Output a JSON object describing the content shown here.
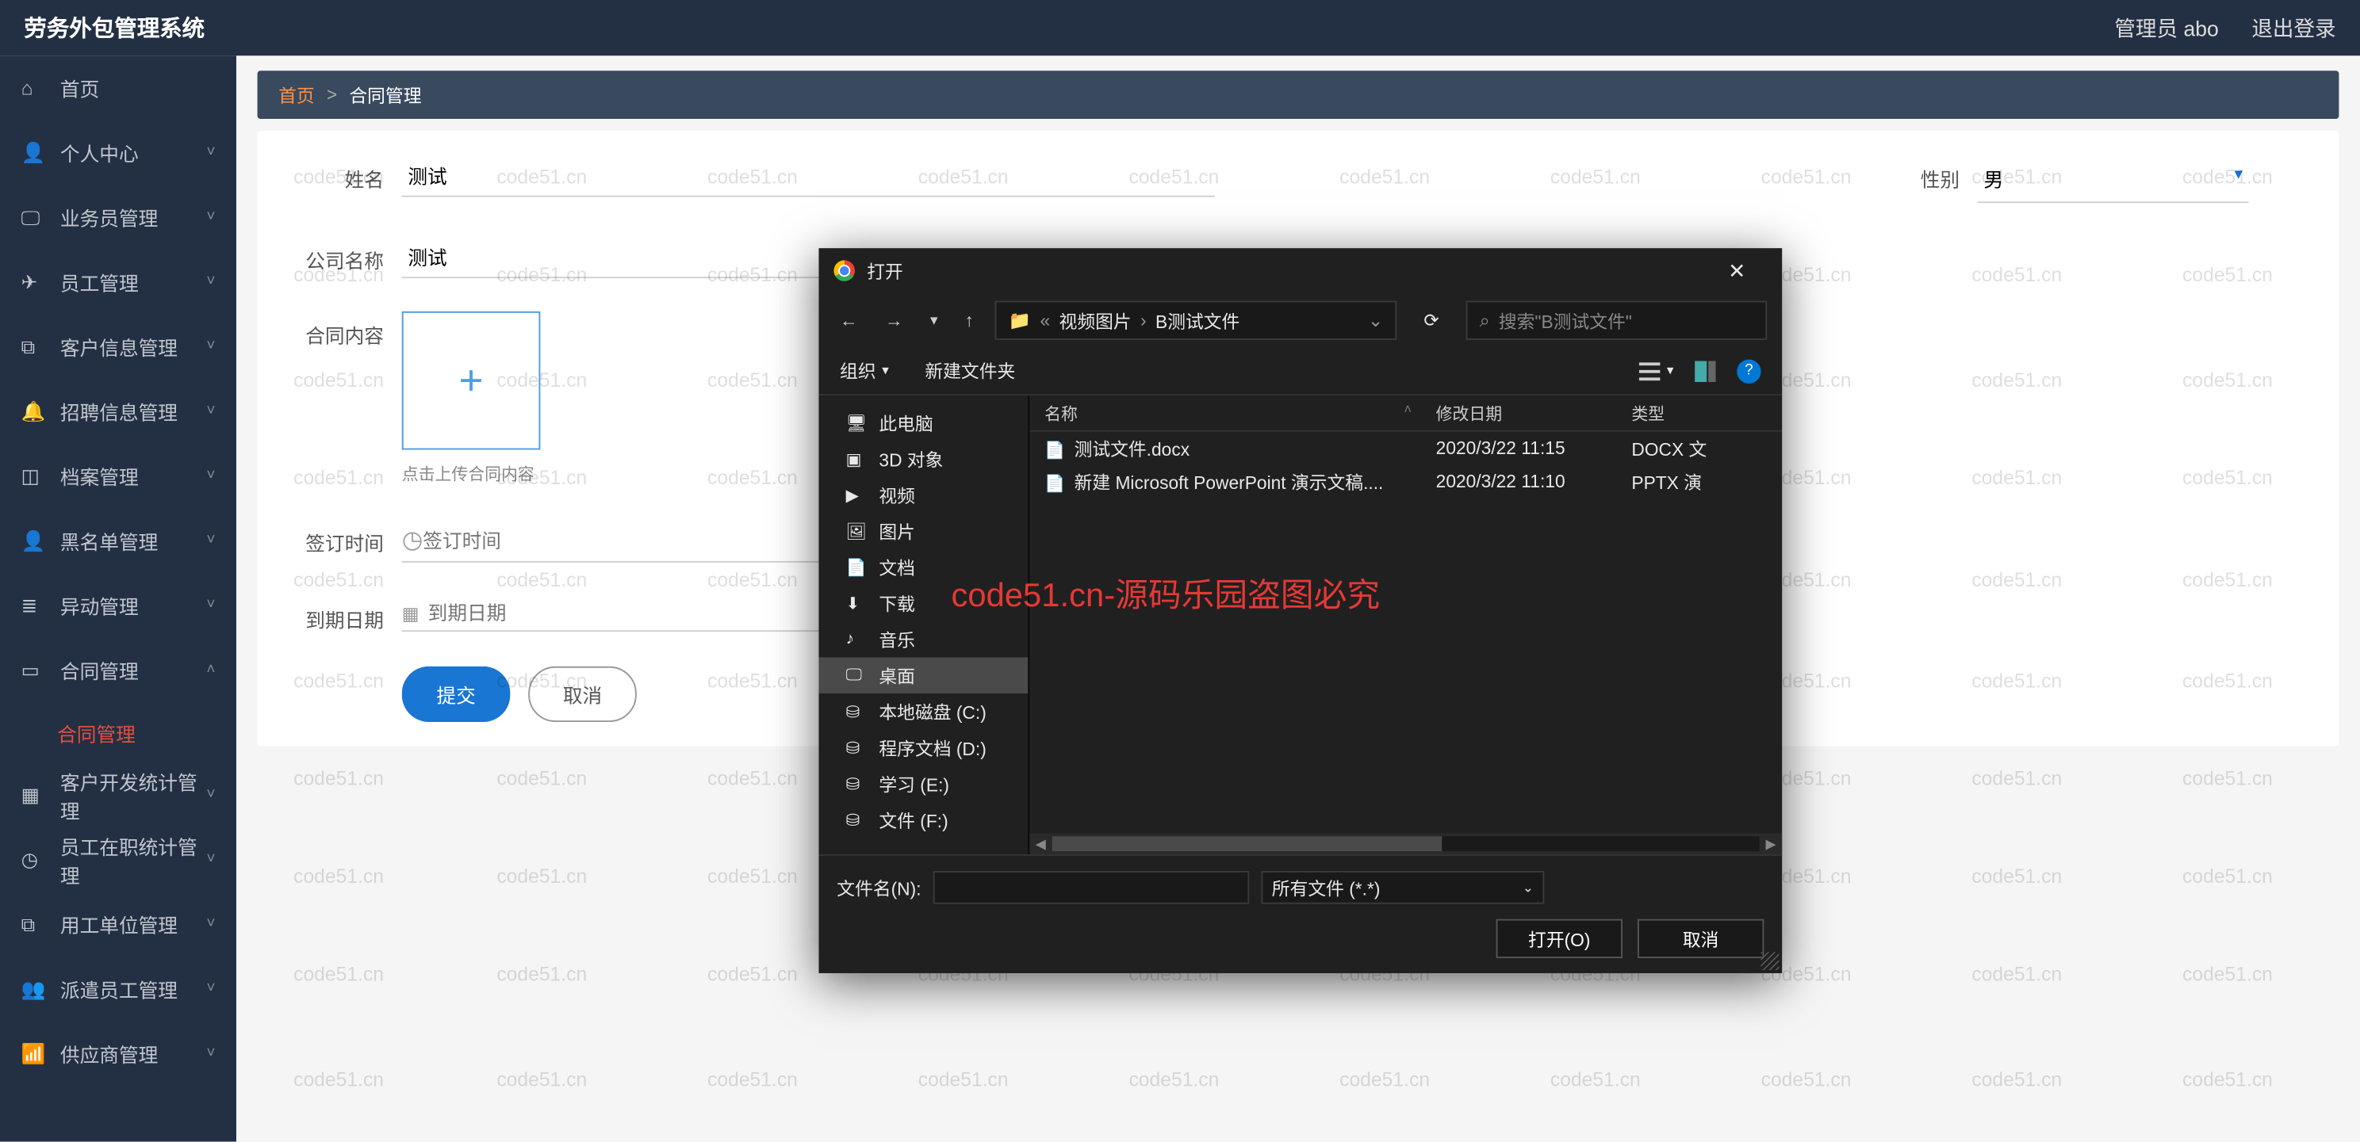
{
  "app": {
    "title": "劳务外包管理系统"
  },
  "header": {
    "admin_label": "管理员 abo",
    "logout_label": "退出登录"
  },
  "sidebar": {
    "items": [
      {
        "label": "首页",
        "icon": "home",
        "expandable": false
      },
      {
        "label": "个人中心",
        "icon": "user",
        "expandable": true
      },
      {
        "label": "业务员管理",
        "icon": "display",
        "expandable": true
      },
      {
        "label": "员工管理",
        "icon": "send",
        "expandable": true
      },
      {
        "label": "客户信息管理",
        "icon": "copy",
        "expandable": true
      },
      {
        "label": "招聘信息管理",
        "icon": "bell",
        "expandable": true
      },
      {
        "label": "档案管理",
        "icon": "bookmark",
        "expandable": true
      },
      {
        "label": "黑名单管理",
        "icon": "user",
        "expandable": true
      },
      {
        "label": "异动管理",
        "icon": "stack",
        "expandable": true
      },
      {
        "label": "合同管理",
        "icon": "doc",
        "expandable": true,
        "open": true,
        "children": [
          {
            "label": "合同管理"
          }
        ]
      },
      {
        "label": "客户开发统计管理",
        "icon": "grid",
        "expandable": true
      },
      {
        "label": "员工在职统计管理",
        "icon": "clock",
        "expandable": true
      },
      {
        "label": "用工单位管理",
        "icon": "copy",
        "expandable": true
      },
      {
        "label": "派遣员工管理",
        "icon": "users",
        "expandable": true
      },
      {
        "label": "供应商管理",
        "icon": "signal",
        "expandable": true
      }
    ]
  },
  "breadcrumb": {
    "home": "首页",
    "sep": ">",
    "current": "合同管理"
  },
  "form": {
    "name_label": "姓名",
    "name_value": "测试",
    "gender_label": "性别",
    "gender_value": "男",
    "company_label": "公司名称",
    "company_value": "测试",
    "content_label": "合同内容",
    "upload_hint": "点击上传合同内容",
    "sign_label": "签订时间",
    "sign_placeholder": "签订时间",
    "due_label": "到期日期",
    "due_placeholder": "到期日期",
    "submit_label": "提交",
    "cancel_label": "取消"
  },
  "watermark": {
    "text": "code51.cn",
    "red_text": "code51.cn-源码乐园盗图必究"
  },
  "dialog": {
    "title": "打开",
    "path": {
      "seg1": "视频图片",
      "seg2": "B测试文件"
    },
    "search_placeholder": "搜索\"B测试文件\"",
    "toolbar": {
      "organize": "组织",
      "new_folder": "新建文件夹"
    },
    "tree": [
      {
        "label": "此电脑",
        "icon": "pc"
      },
      {
        "label": "3D 对象",
        "icon": "3d"
      },
      {
        "label": "视频",
        "icon": "video"
      },
      {
        "label": "图片",
        "icon": "image"
      },
      {
        "label": "文档",
        "icon": "doc"
      },
      {
        "label": "下载",
        "icon": "download"
      },
      {
        "label": "音乐",
        "icon": "music"
      },
      {
        "label": "桌面",
        "icon": "desktop",
        "selected": true
      },
      {
        "label": "本地磁盘 (C:)",
        "icon": "drive"
      },
      {
        "label": "程序文档 (D:)",
        "icon": "drive"
      },
      {
        "label": "学习 (E:)",
        "icon": "drive"
      },
      {
        "label": "文件 (F:)",
        "icon": "drive"
      }
    ],
    "headers": {
      "name": "名称",
      "date": "修改日期",
      "type": "类型"
    },
    "files": [
      {
        "name": "测试文件.docx",
        "date": "2020/3/22 11:15",
        "type": "DOCX 文"
      },
      {
        "name": "新建 Microsoft PowerPoint 演示文稿....",
        "date": "2020/3/22 11:10",
        "type": "PPTX 演"
      }
    ],
    "filename_label": "文件名(N):",
    "filter_value": "所有文件 (*.*)",
    "open_btn": "打开(O)",
    "cancel_btn": "取消"
  }
}
